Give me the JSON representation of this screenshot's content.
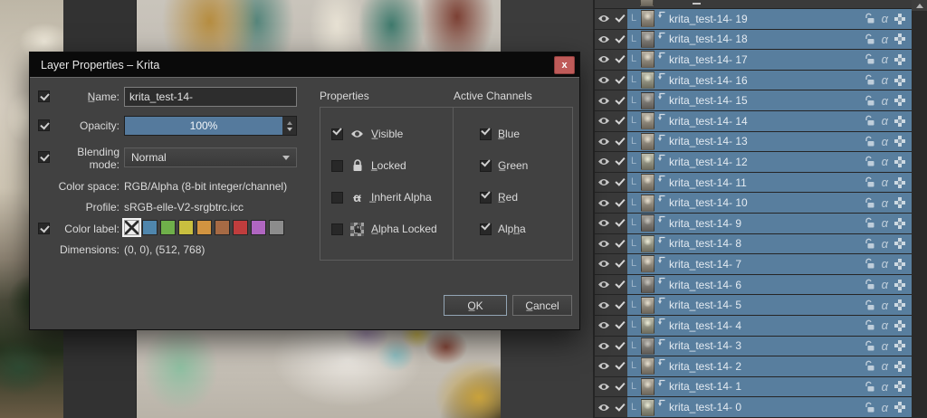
{
  "app": {
    "background": "#3c3c3c",
    "selection_blue": "#587e9e"
  },
  "dialog": {
    "title": "Layer Properties – Krita",
    "close_label": "x",
    "fields": {
      "name_label": "N̲ame:",
      "name_value": "krita_test-14-",
      "opacity_label": "Opacity:",
      "opacity_value": "100%",
      "blending_label": "Blending mode:",
      "blending_value": "Normal",
      "colorspace_label": "Color space:",
      "colorspace_value": "RGB/Alpha (8-bit integer/channel)",
      "profile_label": "Profile:",
      "profile_value": "sRGB-elle-V2-srgbtrc.icc",
      "colorlabel_label": "Color label:",
      "dimensions_label": "Dimensions:",
      "dimensions_value": "(0, 0), (512, 768)"
    },
    "color_swatches": [
      "none",
      "#4f86ad",
      "#6faf4a",
      "#c9bf3f",
      "#d29440",
      "#a66a44",
      "#c03d3d",
      "#b066c1",
      "#8c8c8c"
    ],
    "properties_group": {
      "header": "Properties",
      "items": [
        {
          "label": "V̲isible",
          "checked": true,
          "icon": "eye-icon"
        },
        {
          "label": "L̲ocked",
          "checked": false,
          "icon": "lock-icon"
        },
        {
          "label": "I̲nherit Alpha",
          "checked": false,
          "icon": "inherit-alpha-icon"
        },
        {
          "label": "A̲lpha Locked",
          "checked": false,
          "icon": "alpha-locked-icon"
        }
      ]
    },
    "channels_group": {
      "header": "Active Channels",
      "items": [
        {
          "label": "B̲lue",
          "checked": true
        },
        {
          "label": "G̲reen",
          "checked": true
        },
        {
          "label": "R̲ed",
          "checked": true
        },
        {
          "label": "Alph̲a",
          "checked": true
        }
      ]
    },
    "buttons": {
      "ok": "O̲K",
      "cancel": "C̲ancel"
    }
  },
  "icons": {
    "alpha_char": "α"
  },
  "layers": {
    "badge": "L",
    "rows": [
      {
        "name": "krita_test-14- 19"
      },
      {
        "name": "krita_test-14- 18"
      },
      {
        "name": "krita_test-14- 17"
      },
      {
        "name": "krita_test-14- 16"
      },
      {
        "name": "krita_test-14- 15"
      },
      {
        "name": "krita_test-14- 14"
      },
      {
        "name": "krita_test-14- 13"
      },
      {
        "name": "krita_test-14- 12"
      },
      {
        "name": "krita_test-14- 11"
      },
      {
        "name": "krita_test-14- 10"
      },
      {
        "name": "krita_test-14- 9"
      },
      {
        "name": "krita_test-14- 8"
      },
      {
        "name": "krita_test-14- 7"
      },
      {
        "name": "krita_test-14- 6"
      },
      {
        "name": "krita_test-14- 5"
      },
      {
        "name": "krita_test-14- 4"
      },
      {
        "name": "krita_test-14- 3"
      },
      {
        "name": "krita_test-14- 2"
      },
      {
        "name": "krita_test-14- 1"
      },
      {
        "name": "krita_test-14- 0"
      }
    ]
  }
}
